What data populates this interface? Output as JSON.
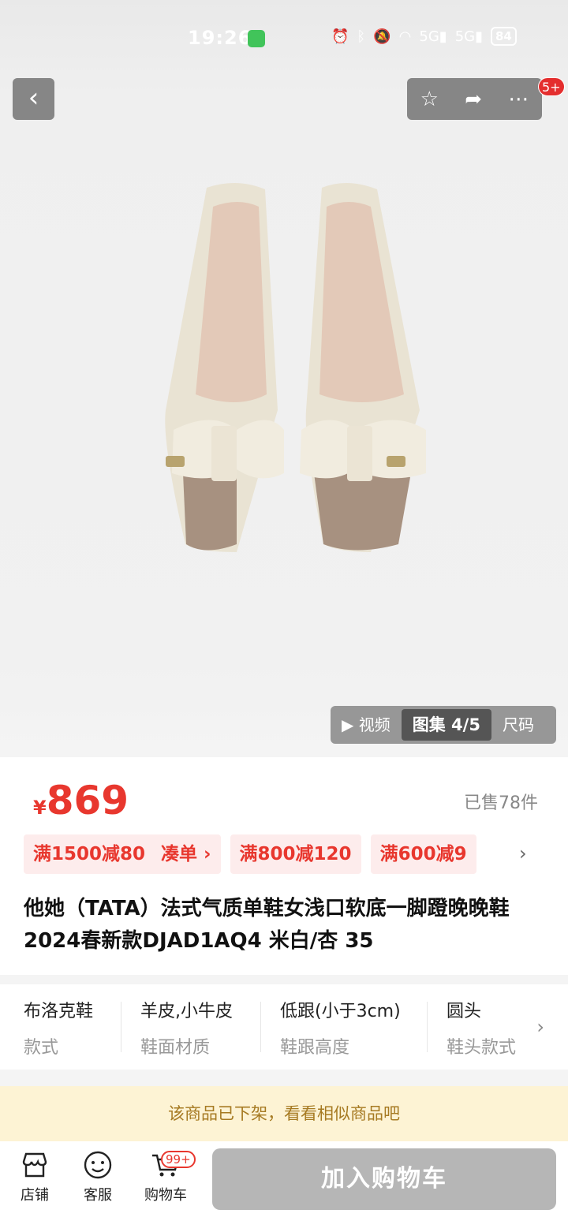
{
  "status_bar": {
    "time": "19:26",
    "network": "5G",
    "battery": "84"
  },
  "top_bar": {
    "badge": "5+"
  },
  "gallery_tabs": [
    {
      "label": "▶ 视频",
      "active": false
    },
    {
      "label": "图集 4/5",
      "active": true
    },
    {
      "label": "尺码",
      "active": false
    }
  ],
  "product": {
    "currency": "¥",
    "price": "869",
    "sold": "已售78件",
    "coupons": [
      {
        "label": "满1500减80",
        "extra": "凑单 ›"
      },
      {
        "label": "满800减120",
        "extra": ""
      },
      {
        "label": "满600减9",
        "extra": ""
      }
    ],
    "title": "他她（TATA）法式气质单鞋女浅口软底一脚蹬晚晚鞋2024春新款DJAD1AQ4 米白/杏 35"
  },
  "specs": [
    {
      "value": "布洛克鞋",
      "key": "款式"
    },
    {
      "value": "羊皮,小牛皮",
      "key": "鞋面材质"
    },
    {
      "value": "低跟(小于3cm)",
      "key": "鞋跟高度"
    },
    {
      "value": "圆头",
      "key": "鞋头款式"
    }
  ],
  "notice": "该商品已下架，看看相似商品吧",
  "bottom_bar": {
    "shop_label": "店铺",
    "service_label": "客服",
    "cart_label": "购物车",
    "cart_badge": "99+",
    "add_to_cart": "加入购物车"
  },
  "colors": {
    "price_red": "#e8372e",
    "notice_bg": "#fdf3d4",
    "button_gray": "#b6b6b6"
  }
}
